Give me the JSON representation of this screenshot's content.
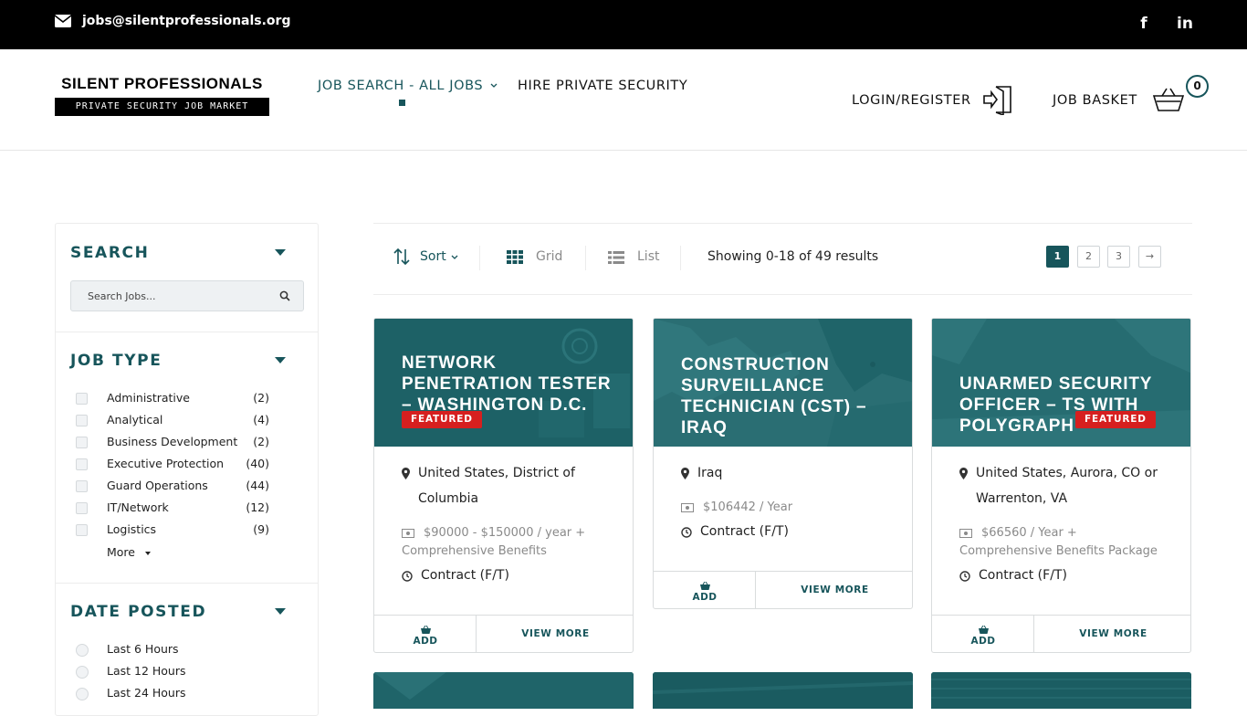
{
  "topbar": {
    "email": "jobs@silentprofessionals.org",
    "social_facebook": "f",
    "social_linkedin": "in"
  },
  "header": {
    "logo_title": "SILENT PROFESSIONALS",
    "logo_subtitle": "PRIVATE SECURITY JOB MARKET",
    "nav": {
      "job_search": "JOB SEARCH - ALL JOBS",
      "hire": "HIRE PRIVATE SECURITY"
    },
    "login": "LOGIN/REGISTER",
    "basket": "JOB BASKET",
    "basket_count": "0"
  },
  "sidebar": {
    "search_title": "SEARCH",
    "search_placeholder": "Search Jobs...",
    "job_type_title": "JOB TYPE",
    "job_types": [
      {
        "label": "Administrative",
        "count": "(2)"
      },
      {
        "label": "Analytical",
        "count": "(4)"
      },
      {
        "label": "Business Development",
        "count": "(2)"
      },
      {
        "label": "Executive Protection",
        "count": "(40)"
      },
      {
        "label": "Guard Operations",
        "count": "(44)"
      },
      {
        "label": "IT/Network",
        "count": "(12)"
      },
      {
        "label": "Logistics",
        "count": "(9)"
      }
    ],
    "more": "More",
    "date_title": "DATE POSTED",
    "dates": [
      "Last 6 Hours",
      "Last 12 Hours",
      "Last 24 Hours"
    ]
  },
  "toolbar": {
    "sort": "Sort",
    "grid": "Grid",
    "list": "List",
    "showing": "Showing 0-18 of 49 results",
    "pages": [
      "1",
      "2",
      "3",
      "→"
    ]
  },
  "cards": [
    {
      "title": "NETWORK PENETRATION TESTER – WASHINGTON D.C.",
      "featured": "FEATURED",
      "location": "United States, District of Columbia",
      "salary_line1": "$90000 - $150000 / year +",
      "salary_line2": "Comprehensive Benefits",
      "contract": "Contract (F/T)",
      "add": "ADD",
      "view": "VIEW MORE"
    },
    {
      "title": "CONSTRUCTION SURVEILLANCE TECHNICIAN (CST) – IRAQ",
      "location": "Iraq",
      "salary_line1": "$106442 / Year",
      "contract": "Contract (F/T)",
      "add": "ADD",
      "view": "VIEW MORE"
    },
    {
      "title": "UNARMED SECURITY OFFICER – TS WITH POLYGRAPH",
      "featured": "FEATURED",
      "location": "United States, Aurora, CO or Warrenton, VA",
      "salary_line1": "$66560 / Year +",
      "salary_line2": "Comprehensive Benefits Package",
      "contract": "Contract (F/T)",
      "add": "ADD",
      "view": "VIEW MORE"
    }
  ],
  "colors": {
    "brand_teal": "#17555b",
    "card_bg": "#1f6469",
    "featured_red": "#d61f1f"
  }
}
